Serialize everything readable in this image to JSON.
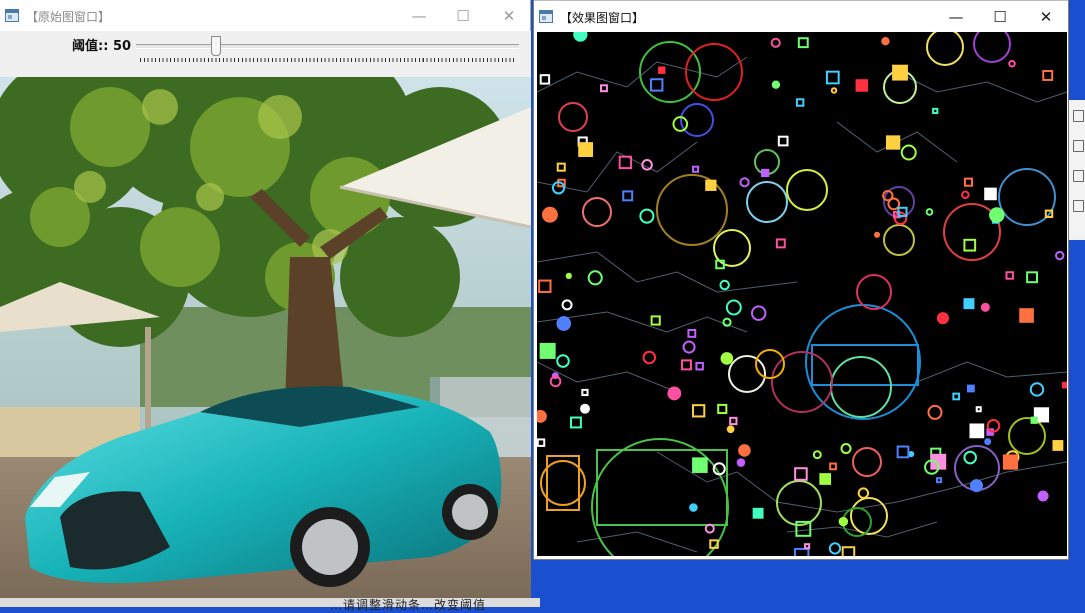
{
  "windows": {
    "original": {
      "title": "【原始图窗口】",
      "controls": {
        "minimize": "—",
        "maximize": "☐",
        "close": "✕"
      },
      "trackbar": {
        "label": "阈值:",
        "value": "50",
        "max": 100,
        "position_fraction": 0.2
      },
      "image_description_icon": "photo-car-under-tree"
    },
    "result": {
      "title": "【效果图窗口】",
      "controls": {
        "minimize": "—",
        "maximize": "☐",
        "close": "✕"
      }
    }
  },
  "desktop": {
    "background_color": "#1a4fd0",
    "bottom_text": "…请调整滑动条…改变阈值"
  },
  "colors": {
    "result_background": "#000000",
    "car_body": "#17b3b8"
  }
}
